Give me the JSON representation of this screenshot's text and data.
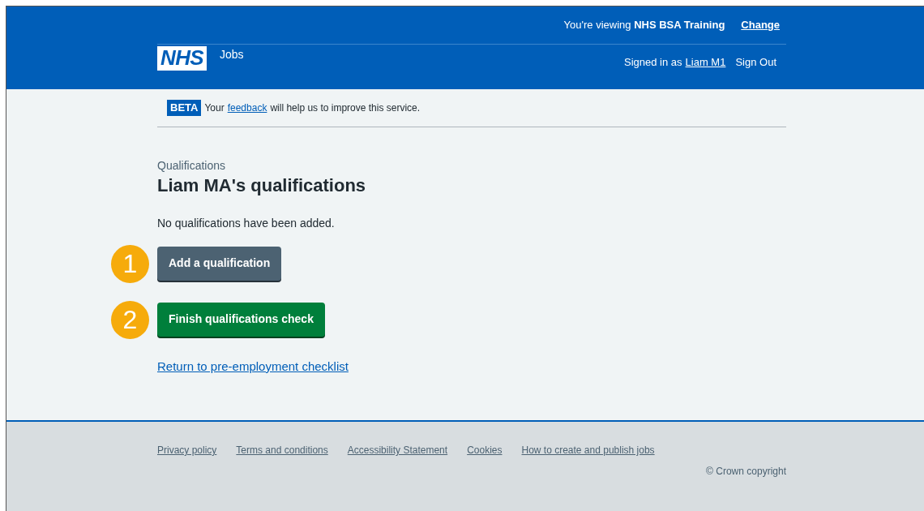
{
  "header": {
    "logo": "NHS",
    "service": "Jobs",
    "viewing_prefix": "You're viewing",
    "viewing_org": "NHS BSA Training",
    "change_link": "Change",
    "signed_in_prefix": "Signed in as",
    "user_link": "Liam M1",
    "sign_out": "Sign Out"
  },
  "phase_banner": {
    "tag": "BETA",
    "before": "Your",
    "link": "feedback",
    "after": "will help us to improve this service."
  },
  "caption": "Qualifications",
  "heading": "Liam MA's qualifications",
  "body": "No qualifications have been added.",
  "actions": [
    {
      "kind": "secondary",
      "label": "Add a qualification",
      "callout": "1"
    },
    {
      "kind": "primary",
      "label": "Finish qualifications check",
      "callout": "2"
    }
  ],
  "back_link": "Return to pre-employment checklist",
  "footer": {
    "links": [
      "Privacy policy",
      "Terms and conditions",
      "Accessibility Statement",
      "Cookies",
      "How to create and publish jobs"
    ],
    "copyright": "© Crown copyright"
  }
}
